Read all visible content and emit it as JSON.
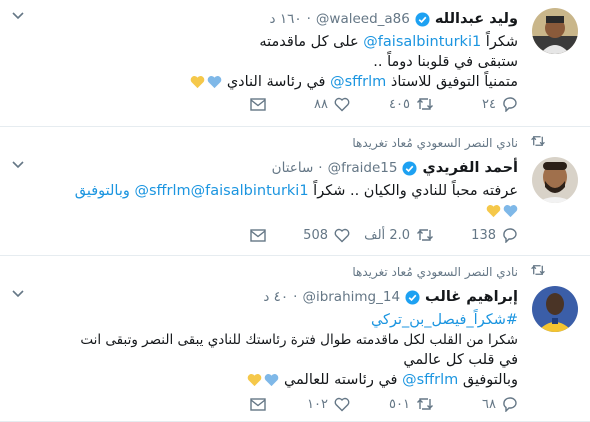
{
  "tweets": [
    {
      "retweet_label": "",
      "name": "وليد عبدالله",
      "handle": "@waleed_a86",
      "time": "١٦٠ د",
      "lines": [
        {
          "pre": "شكراً ",
          "link": "@faisalbinturki1",
          "post": " على كل ماقدمته"
        },
        {
          "pre": "ستبقى في قلوبنا دوماً ..",
          "link": "",
          "post": ""
        },
        {
          "pre": "متمنياً التوفيق للاستاذ ",
          "link": "@sffrlm",
          "post": " في رئاسة النادي"
        }
      ],
      "hearts": [
        "#7fb8e8",
        "#f5c84a"
      ],
      "replies": "٢٤",
      "retweets": "٤٠٥",
      "likes": "٨٨"
    },
    {
      "retweet_label": "نادي النصر السعودي مُعاد تغريدها",
      "name": "أحمد الفريدي",
      "handle": "@fraide15",
      "time": "ساعتان",
      "lines": [
        {
          "pre": "عرفته محباً للنادي والكيان .. شكراً ",
          "link": "@faisalbinturki1",
          "post": " وبالتوفيق @sffrlm"
        }
      ],
      "hearts": [
        "#7fb8e8",
        "#f5c84a"
      ],
      "replies": "138",
      "retweets": "2.0 ألف",
      "likes": "508"
    },
    {
      "retweet_label": "نادي النصر السعودي مُعاد تغريدها",
      "name": "إبراهيم غالب",
      "handle": "@ibrahimg_14",
      "time": "٤٠ د",
      "lines": [
        {
          "pre": "",
          "link": "#شكراً_فيصل_بن_تركي",
          "post": ""
        },
        {
          "pre": "شكرا من القلب لكل ماقدمته طوال فترة رئاستك للنادي يبقى النصر وتبقى انت",
          "link": "",
          "post": ""
        },
        {
          "pre": "في قلب كل عالمي",
          "link": "",
          "post": ""
        },
        {
          "pre": "وبالتوفيق ",
          "link": "@sffrlm",
          "post": " في رئاسته للعالمي"
        }
      ],
      "hearts": [
        "#7fb8e8",
        "#f5c84a"
      ],
      "replies": "٦٨",
      "retweets": "٥٠١",
      "likes": "١٠٢"
    }
  ],
  "colors": {
    "link": "#1b95e0",
    "muted": "#657786",
    "verified": "#1da1f2"
  },
  "icons": [
    "reply-icon",
    "retweet-icon",
    "like-icon",
    "message-icon",
    "verified-icon",
    "chevron-down-icon"
  ]
}
